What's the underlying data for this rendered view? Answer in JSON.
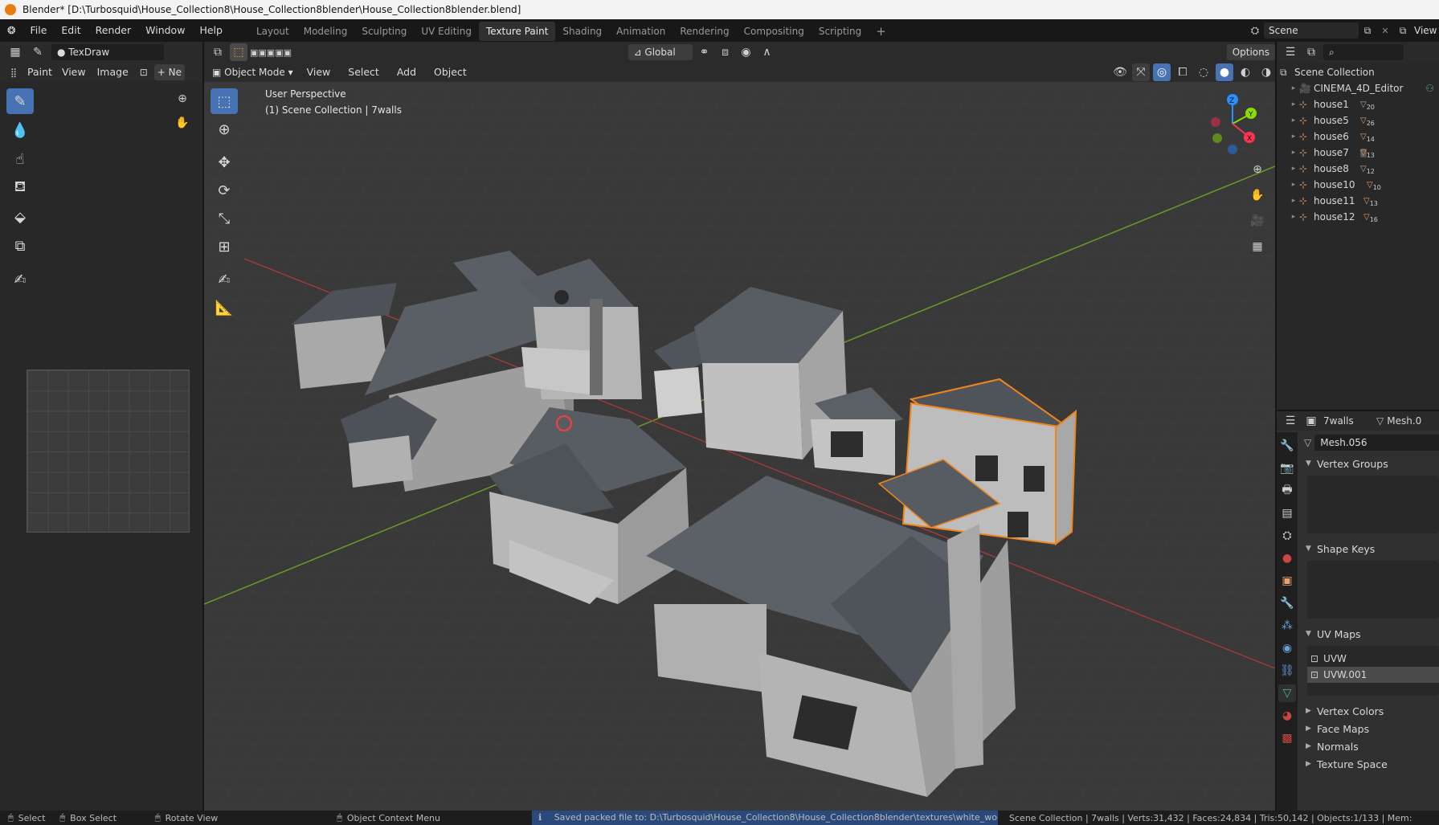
{
  "window": {
    "title": "Blender* [D:\\Turbosquid\\House_Collection8\\House_Collection8blender\\House_Collection8blender.blend]"
  },
  "menu": [
    "File",
    "Edit",
    "Render",
    "Window",
    "Help"
  ],
  "workspaces": [
    "Layout",
    "Modeling",
    "Sculpting",
    "UV Editing",
    "Texture Paint",
    "Shading",
    "Animation",
    "Rendering",
    "Compositing",
    "Scripting"
  ],
  "active_workspace": "Texture Paint",
  "scene": {
    "name": "Scene",
    "view_layer": "View L"
  },
  "image_editor": {
    "brush_name": "TexDraw",
    "mode": "Paint",
    "menus": [
      "View",
      "Image"
    ],
    "new_label": "Ne"
  },
  "viewport": {
    "mode": "Object Mode",
    "menus": [
      "View",
      "Select",
      "Add",
      "Object"
    ],
    "transform_orientation": "Global",
    "options_label": "Options",
    "overlay_title": "User Perspective",
    "overlay_subtitle": "(1) Scene Collection | 7walls",
    "axis_labels": {
      "z": "Z",
      "y": "Y",
      "x": "X"
    }
  },
  "outliner": {
    "root": "Scene Collection",
    "items": [
      {
        "name": "CINEMA_4D_Editor",
        "badge": ""
      },
      {
        "name": "house1",
        "badge": "20"
      },
      {
        "name": "house5",
        "badge": "26"
      },
      {
        "name": "house6",
        "badge": "14"
      },
      {
        "name": "house7",
        "badge": "13"
      },
      {
        "name": "house8",
        "badge": "12"
      },
      {
        "name": "house10",
        "badge": "10"
      },
      {
        "name": "house11",
        "badge": "13"
      },
      {
        "name": "house12",
        "badge": "16"
      }
    ]
  },
  "properties": {
    "object_name": "7walls",
    "data_type": "Mesh.0",
    "mesh_name": "Mesh.056",
    "sections": {
      "vertex_groups": "Vertex Groups",
      "shape_keys": "Shape Keys",
      "uv_maps": "UV Maps",
      "vertex_colors": "Vertex Colors",
      "face_maps": "Face Maps",
      "normals": "Normals",
      "texture_space": "Texture Space"
    },
    "uv_maps": [
      "UVW",
      "UVW.001"
    ],
    "active_uv": "UVW.001"
  },
  "statusbar": {
    "select": "Select",
    "box_select": "Box Select",
    "rotate": "Rotate View",
    "context_menu": "Object Context Menu",
    "message": "Saved packed file to: D:\\Turbosquid\\House_Collection8\\House_Collection8blender\\textures\\white_woodTF.jpg",
    "stats": "Scene Collection | 7walls | Verts:31,432 | Faces:24,834 | Tris:50,142 | Objects:1/133 | Mem:"
  },
  "colors": {
    "accent": "#4772b3",
    "selection": "#f0851a",
    "x_axis": "#ff3352",
    "y_axis": "#8bdc00",
    "z_axis": "#2890ff"
  }
}
